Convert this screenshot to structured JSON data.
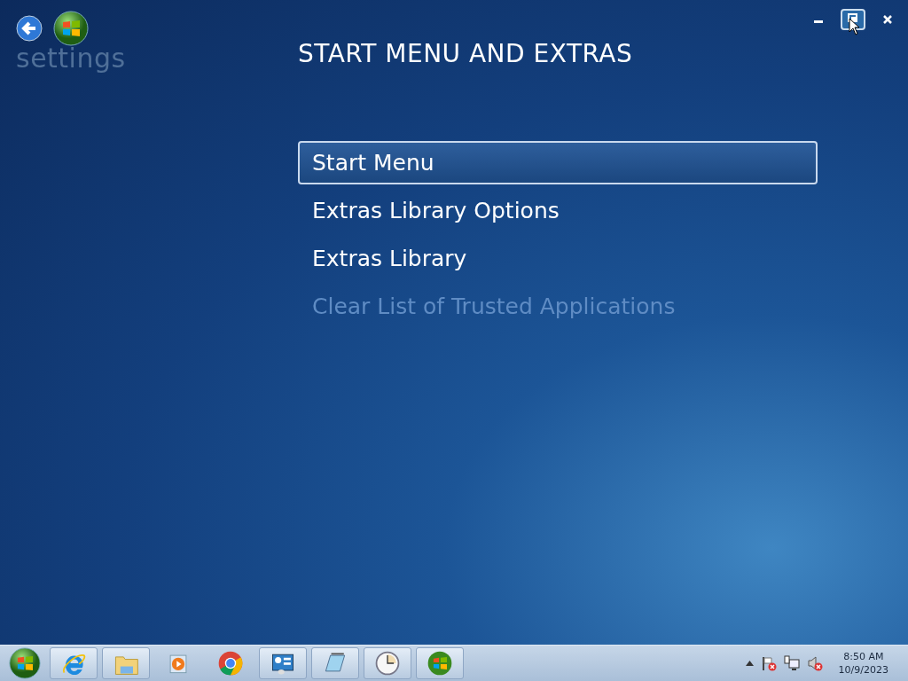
{
  "app": {
    "caption": "settings"
  },
  "page_title": "START MENU AND EXTRAS",
  "menu": [
    {
      "label": "Start Menu",
      "selected": true,
      "disabled": false
    },
    {
      "label": "Extras Library Options",
      "selected": false,
      "disabled": false
    },
    {
      "label": "Extras Library",
      "selected": false,
      "disabled": false
    },
    {
      "label": "Clear List of Trusted Applications",
      "selected": false,
      "disabled": true
    }
  ],
  "taskbar": {
    "items": [
      {
        "kind": "ie",
        "open": true
      },
      {
        "kind": "folder",
        "open": true
      },
      {
        "kind": "player",
        "open": false
      },
      {
        "kind": "chrome",
        "open": false
      },
      {
        "kind": "panel",
        "open": true
      },
      {
        "kind": "notepad",
        "open": true
      },
      {
        "kind": "clock",
        "open": true
      },
      {
        "kind": "windows",
        "open": true
      }
    ],
    "time": "8:50 AM",
    "date": "10/9/2023"
  }
}
